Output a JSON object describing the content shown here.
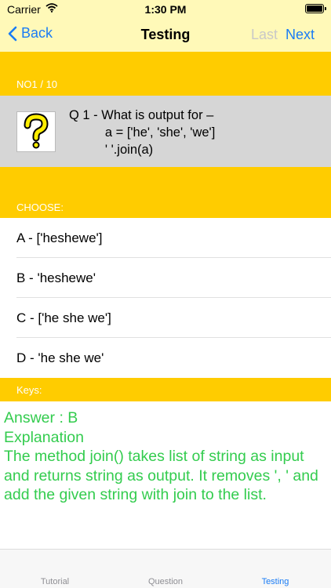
{
  "status_bar": {
    "carrier": "Carrier",
    "time": "1:30 PM"
  },
  "nav": {
    "back_label": "Back",
    "title": "Testing",
    "last_label": "Last",
    "next_label": "Next"
  },
  "progress": {
    "label": "NO1 / 10"
  },
  "question": {
    "text": "Q 1 - What is output for –\n          a = ['he', 'she', 'we']\n          ' '.join(a)",
    "icon": "question-mark-icon"
  },
  "choose_header": "CHOOSE:",
  "options": [
    {
      "label": "A - ['heshewe']"
    },
    {
      "label": "B - 'heshewe'"
    },
    {
      "label": "C - ['he she we']"
    },
    {
      "label": "D - 'he she we'"
    }
  ],
  "keys_header": "Keys:",
  "answer": {
    "answer_line": "Answer : B",
    "explanation_title": "Explanation",
    "explanation_text": "The method join() takes list of string as input and returns string as output. It removes ', ' and add the given string with join to the list."
  },
  "tabs": [
    {
      "label": "Tutorial",
      "active": false
    },
    {
      "label": "Question",
      "active": false
    },
    {
      "label": "Testing",
      "active": true
    }
  ],
  "colors": {
    "accent": "#1a7cf5",
    "header_yellow": "#ffcc00",
    "navbar": "#fff9b8",
    "answer_green": "#33cc4e"
  }
}
